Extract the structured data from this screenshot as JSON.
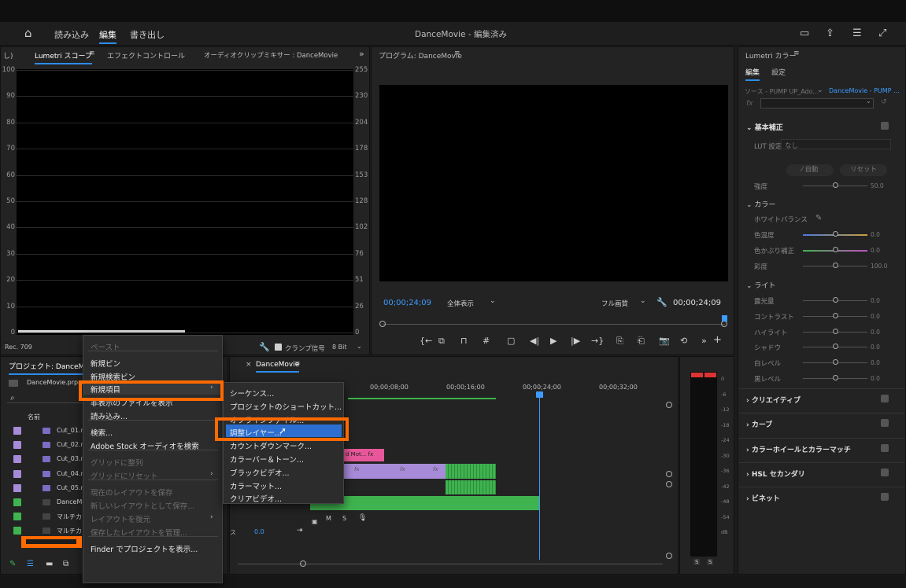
{
  "header": {
    "nav": [
      "読み込み",
      "編集",
      "書き出し"
    ],
    "active_nav": "編集",
    "title": "DanceMovie - 編集済み"
  },
  "scope_panel": {
    "tabs": [
      "Lumetri スコープ",
      "エフェクトコントロール",
      "オーディオクリップミキサー : DanceMovie"
    ],
    "cut_label": "し)",
    "left_scale": [
      "100",
      "90",
      "80",
      "70",
      "60",
      "50",
      "40",
      "30",
      "20",
      "10",
      "0"
    ],
    "right_scale": [
      "255",
      "230",
      "204",
      "178",
      "153",
      "128",
      "102",
      "76",
      "51",
      "26",
      "0"
    ],
    "rec_label": "Rec. 709",
    "clamp_label": "クランプ信号",
    "bit_select": "8 Bit"
  },
  "program_monitor": {
    "title": "プログラム: DanceMovie",
    "timecode_left": "00;00;24;09",
    "zoom_select": "全体表示",
    "quality_select": "フル画質",
    "timecode_right": "00;00;24;09"
  },
  "lumetri": {
    "title": "Lumetri カラー",
    "tabs": [
      "編集",
      "設定"
    ],
    "source_label": "ソース - PUMP UP_Ado...",
    "target_label": "DanceMovie - PUMP ...",
    "fx_label": "fx",
    "basic": {
      "title": "基本補正",
      "lut_label": "LUT 設定",
      "lut_value": "なし",
      "auto_btn": "自動",
      "reset_btn": "リセット",
      "intensity_label": "強度",
      "intensity_value": "50.0",
      "color_title": "カラー",
      "white_balance": "ホワイトバランス",
      "color_rows": [
        {
          "label": "色温度",
          "value": "0.0"
        },
        {
          "label": "色かぶり補正",
          "value": "0.0"
        },
        {
          "label": "彩度",
          "value": "100.0"
        }
      ],
      "light_title": "ライト",
      "light_rows": [
        {
          "label": "露光量",
          "value": "0.0"
        },
        {
          "label": "コントラスト",
          "value": "0.0"
        },
        {
          "label": "ハイライト",
          "value": "0.0"
        },
        {
          "label": "シャドウ",
          "value": "0.0"
        },
        {
          "label": "白レベル",
          "value": "0.0"
        },
        {
          "label": "黒レベル",
          "value": "0.0"
        }
      ]
    },
    "sections": [
      "クリエイティブ",
      "カーブ",
      "カラーホイールとカラーマッチ",
      "HSL セカンダリ",
      "ビネット"
    ]
  },
  "project_panel": {
    "title": "プロジェクト: DanceMovie",
    "file": "DanceMovie.prproj",
    "col_name": "名前",
    "items": [
      {
        "name": "Cut_01.m",
        "color": "#a78bd9"
      },
      {
        "name": "Cut_02.m",
        "color": "#a78bd9"
      },
      {
        "name": "Cut_03.m",
        "color": "#a78bd9"
      },
      {
        "name": "Cut_04.m",
        "color": "#a78bd9"
      },
      {
        "name": "Cut_05.m",
        "color": "#a78bd9"
      },
      {
        "name": "DanceMo",
        "color": "#3fb34f"
      },
      {
        "name": "マルチカ",
        "color": "#3fb34f"
      },
      {
        "name": "マルチカ",
        "color": "#3fb34f"
      }
    ]
  },
  "timeline": {
    "tab": "DanceMovie",
    "ruler": [
      "00;00;08;00",
      "00;00;16;00",
      "00;00;24;00",
      "00;00;32;00"
    ],
    "clip_label": "d Mot...",
    "fx": "fx",
    "m_label": "M",
    "s_label": "S",
    "vol_label": "ス",
    "vol_value": "0.0"
  },
  "meter": {
    "scale": [
      "0",
      "-6",
      "-12",
      "-18",
      "-24",
      "-30",
      "-36",
      "-42",
      "-48",
      "-54",
      "dB"
    ],
    "solo": [
      "S",
      "S"
    ]
  },
  "context_menu": {
    "items": [
      {
        "label": "ペースト",
        "disabled": true
      },
      {
        "label": "新規ビン",
        "disabled": false
      },
      {
        "label": "新規検索ビン",
        "disabled": false
      },
      {
        "label": "新規項目",
        "disabled": false,
        "submenu": true,
        "highlight": true
      },
      {
        "label": "非表示のファイルを表示",
        "disabled": false
      },
      {
        "label": "読み込み...",
        "disabled": false
      },
      {
        "label": "検索...",
        "disabled": false
      },
      {
        "label": "Adobe Stock オーディオを検索",
        "disabled": false
      },
      {
        "label": "グリッドに整列",
        "disabled": true
      },
      {
        "label": "グリッドにリセット",
        "disabled": true,
        "submenu": true
      },
      {
        "label": "現在のレイアウトを保存",
        "disabled": true
      },
      {
        "label": "新しいレイアウトとして保存...",
        "disabled": true
      },
      {
        "label": "レイアウトを復元",
        "disabled": true,
        "submenu": true
      },
      {
        "label": "保存したレイアウトを管理...",
        "disabled": true
      },
      {
        "label": "Finder でプロジェクトを表示...",
        "disabled": false
      }
    ]
  },
  "submenu": {
    "items": [
      "シーケンス...",
      "プロジェクトのショートカット...",
      "オフラインファイル...",
      "調整レイヤー...",
      "カウントダウンマーク...",
      "カラーバー＆トーン...",
      "ブラックビデオ...",
      "カラーマット...",
      "クリアビデオ..."
    ],
    "selected": "調整レイヤー..."
  },
  "colors": {
    "accent": "#2d8ceb",
    "highlight": "#ff6a00",
    "audio": "#3fb34f",
    "video": "#a78bd9",
    "clip_pink": "#e8579a"
  }
}
